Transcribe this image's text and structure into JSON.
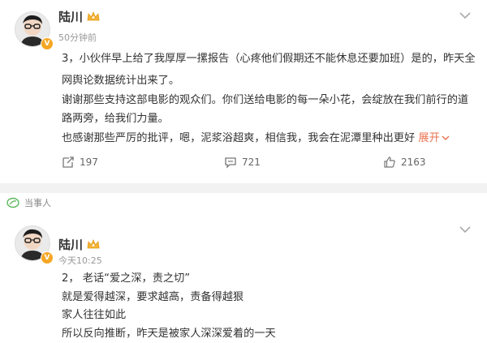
{
  "post1": {
    "author": "陆川",
    "time": "50分钟前",
    "lines": [
      "3，小伙伴早上给了我厚厚一摞报告（心疼他们假期还不能休息还要加班）是的，昨天全",
      "网舆论数据统计出来了。",
      "谢谢那些支持这部电影的观众们。你们送给电影的每一朵小花，会绽放在我们前行的道",
      "路两旁，给我们力量。",
      "也感谢那些严厉的批评，嗯，泥浆浴超爽，相信我，我会在泥潭里种出更好"
    ],
    "expand_label": "展开",
    "expand_icon": "chevron-down-icon",
    "reposts": "197",
    "comments": "721",
    "likes": "2163"
  },
  "tag": {
    "label": "当事人",
    "icon": "leaf-icon"
  },
  "post2": {
    "author": "陆川",
    "time": "今天10:25",
    "lines": [
      "2，  老话“爱之深，责之切”",
      "就是爱得越深，要求越高，责备得越狠",
      "家人往往如此",
      "所以反向推断，昨天是被家人深深爱着的一天"
    ]
  },
  "colors": {
    "accent": "#eb7350",
    "badge": "#f5a623",
    "tag": "#5cb85c"
  }
}
